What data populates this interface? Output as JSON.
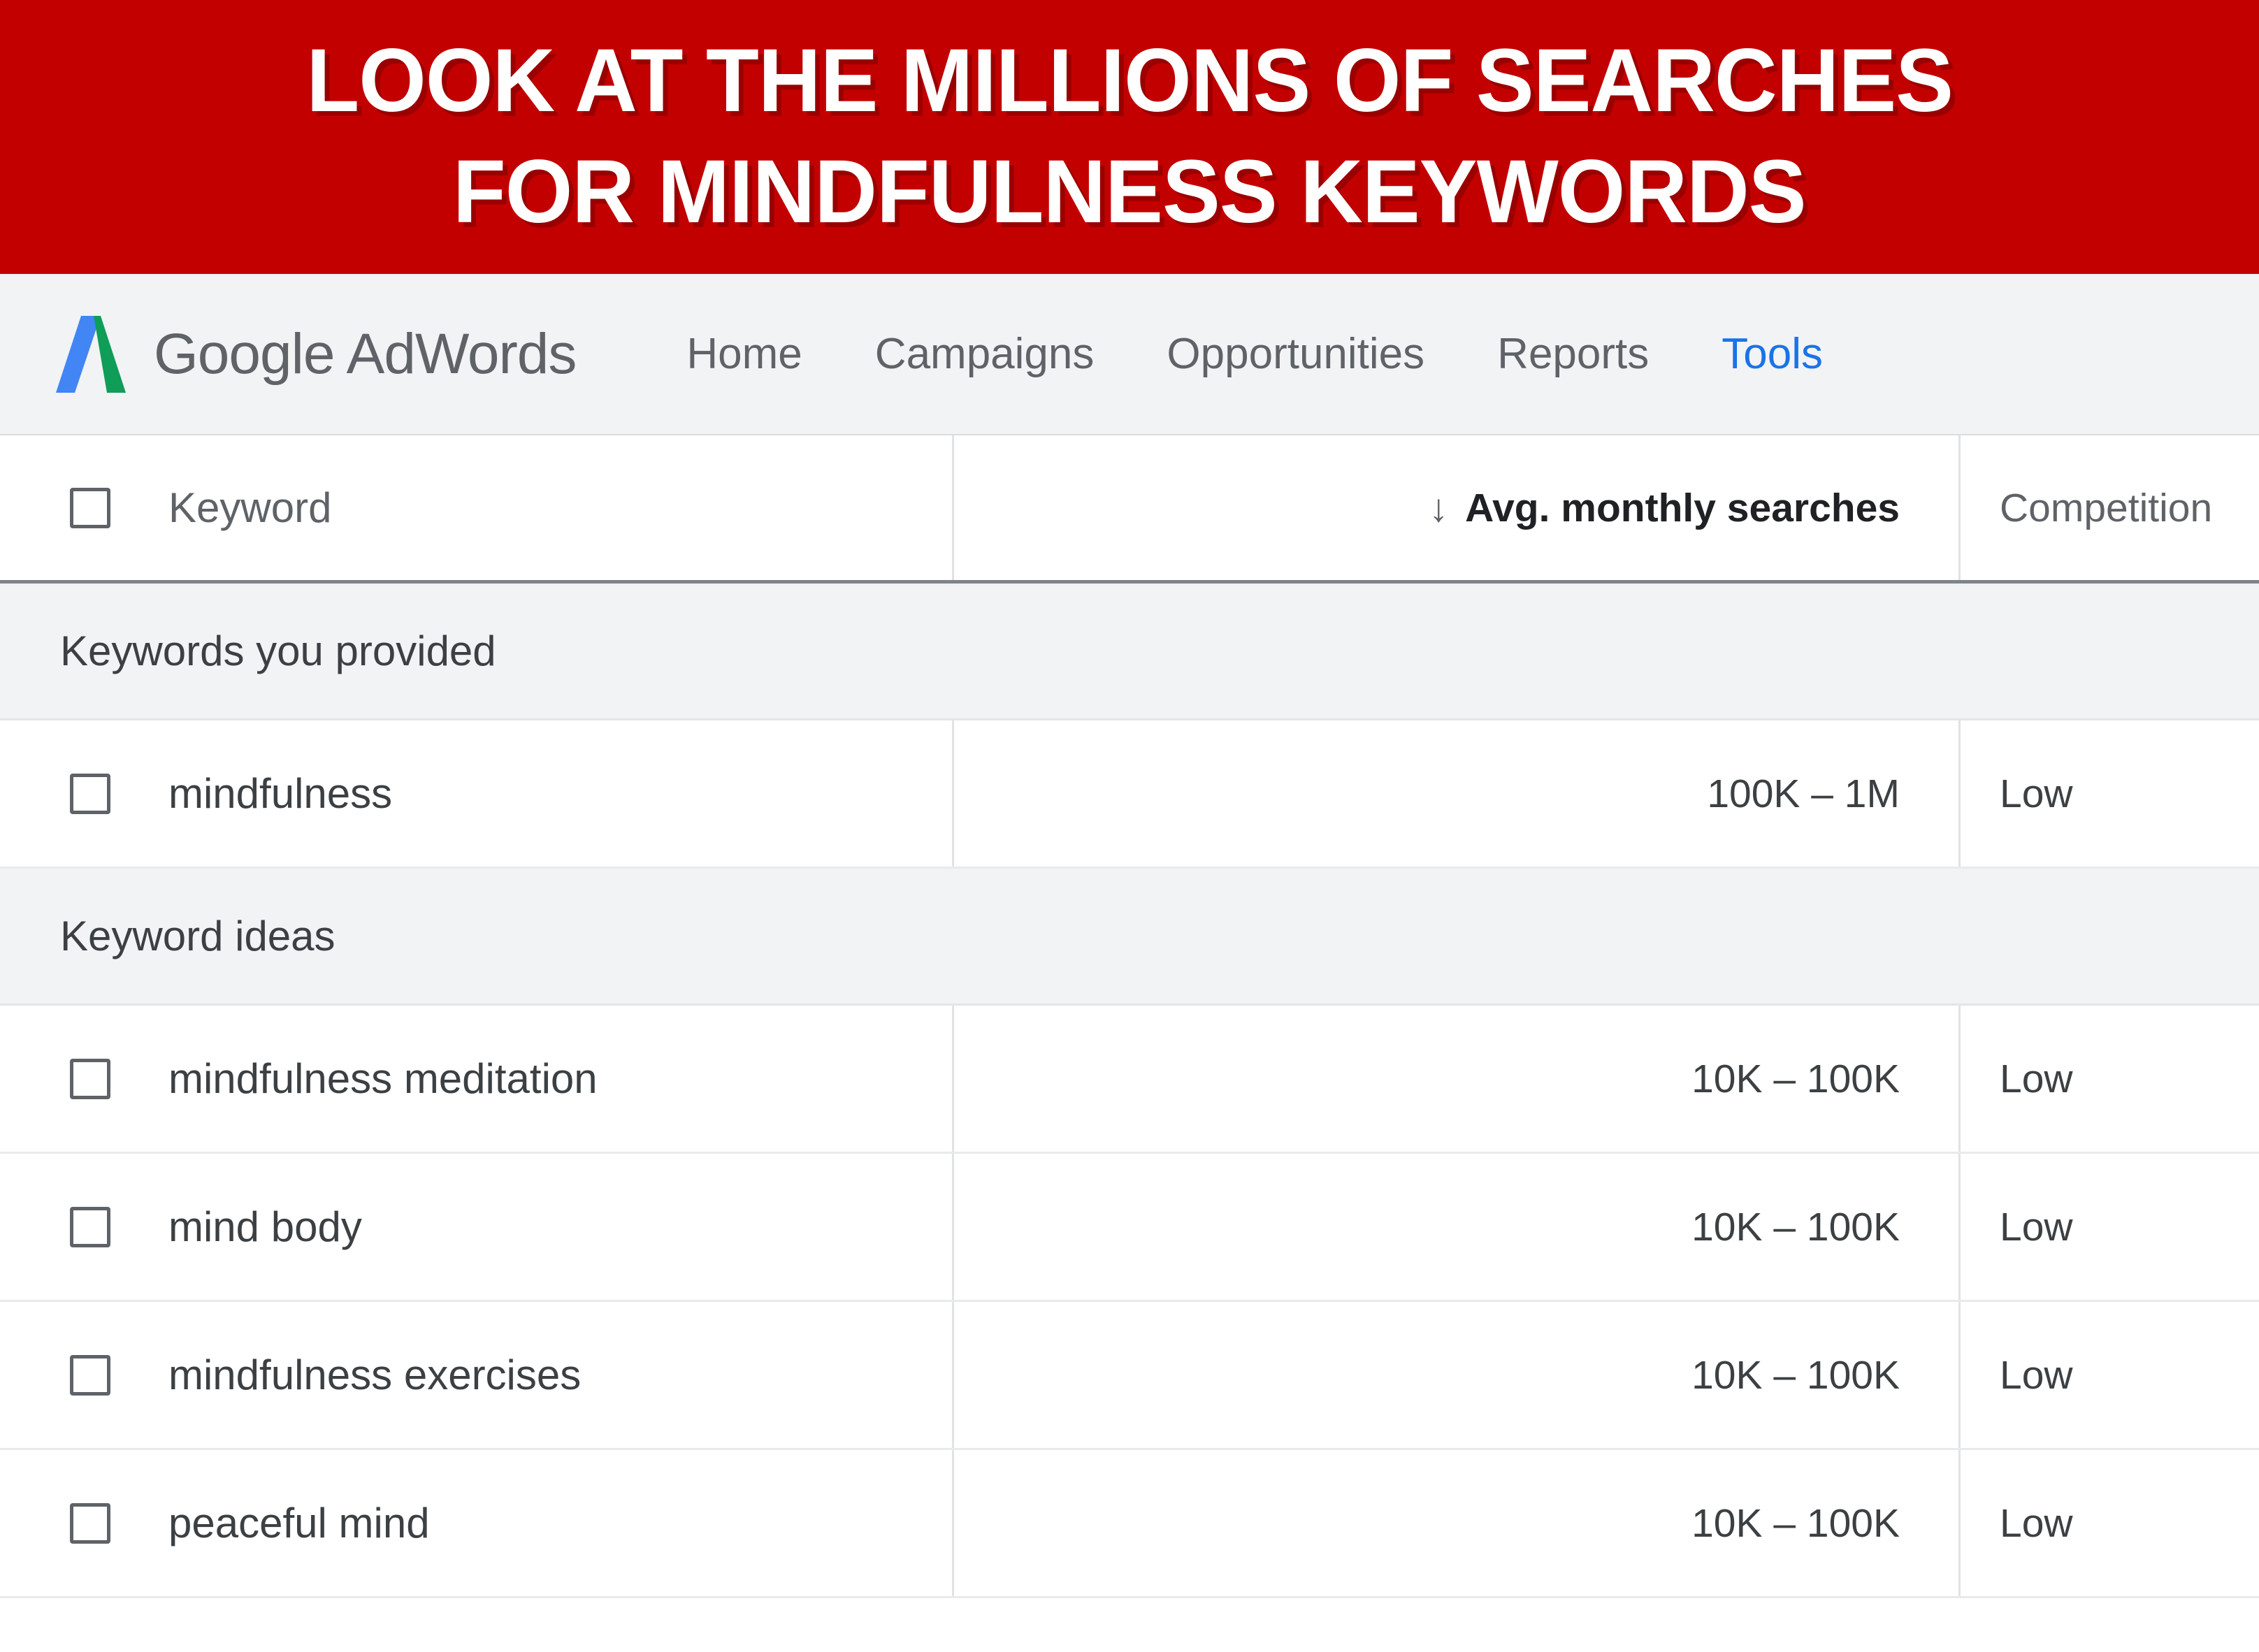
{
  "banner": {
    "line1": "LOOK AT THE MILLIONS OF SEARCHES",
    "line2": "FOR MINDFULNESS KEYWORDS",
    "background_color": "#c30000",
    "text_color": "#ffffff"
  },
  "navbar": {
    "brand": "Google AdWords",
    "logo_icon": "adwords-logo-icon",
    "logo_blue": "#4285f4",
    "logo_green": "#0f9d58",
    "active_color": "#1a73e8",
    "links": [
      {
        "label": "Home",
        "active": false
      },
      {
        "label": "Campaigns",
        "active": false
      },
      {
        "label": "Opportunities",
        "active": false
      },
      {
        "label": "Reports",
        "active": false
      },
      {
        "label": "Tools",
        "active": true
      }
    ]
  },
  "table": {
    "header": {
      "select_all_icon": "checkbox-unchecked-icon",
      "keyword": "Keyword",
      "sort_icon": "sort-descending-arrow-icon",
      "avg_monthly_searches": "Avg. monthly searches",
      "competition": "Competition"
    },
    "sections": [
      {
        "title": "Keywords you provided",
        "rows": [
          {
            "checkbox_icon": "checkbox-unchecked-icon",
            "keyword": "mindfulness",
            "avg_monthly_searches": "100K – 1M",
            "competition": "Low"
          }
        ]
      },
      {
        "title": "Keyword ideas",
        "rows": [
          {
            "checkbox_icon": "checkbox-unchecked-icon",
            "keyword": "mindfulness meditation",
            "avg_monthly_searches": "10K – 100K",
            "competition": "Low"
          },
          {
            "checkbox_icon": "checkbox-unchecked-icon",
            "keyword": "mind body",
            "avg_monthly_searches": "10K – 100K",
            "competition": "Low"
          },
          {
            "checkbox_icon": "checkbox-unchecked-icon",
            "keyword": "mindfulness exercises",
            "avg_monthly_searches": "10K – 100K",
            "competition": "Low"
          },
          {
            "checkbox_icon": "checkbox-unchecked-icon",
            "keyword": "peaceful mind",
            "avg_monthly_searches": "10K – 100K",
            "competition": "Low"
          }
        ]
      }
    ]
  }
}
